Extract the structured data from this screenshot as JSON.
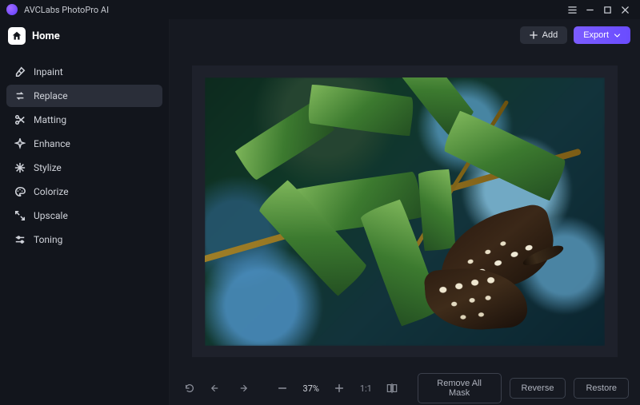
{
  "app": {
    "title": "AVCLabs PhotoPro AI"
  },
  "header": {
    "home_label": "Home",
    "add_label": "Add",
    "export_label": "Export"
  },
  "sidebar": {
    "tools": [
      {
        "id": "inpaint",
        "label": "Inpaint",
        "icon": "eraser-icon",
        "active": false
      },
      {
        "id": "replace",
        "label": "Replace",
        "icon": "swap-icon",
        "active": true
      },
      {
        "id": "matting",
        "label": "Matting",
        "icon": "scissors-icon",
        "active": false
      },
      {
        "id": "enhance",
        "label": "Enhance",
        "icon": "sparkle-icon",
        "active": false
      },
      {
        "id": "stylize",
        "label": "Stylize",
        "icon": "snowflake-icon",
        "active": false
      },
      {
        "id": "colorize",
        "label": "Colorize",
        "icon": "palette-icon",
        "active": false
      },
      {
        "id": "upscale",
        "label": "Upscale",
        "icon": "expand-icon",
        "active": false
      },
      {
        "id": "toning",
        "label": "Toning",
        "icon": "sliders-icon",
        "active": false
      }
    ]
  },
  "canvas": {
    "image_description": "Brown butterfly with white spots perched on green leaves of a yellow-stemmed branch, blurred blue-green bokeh background",
    "zoom_percent": "37%"
  },
  "bottom": {
    "fit_label": "1:1",
    "remove_mask_label": "Remove All Mask",
    "reverse_label": "Reverse",
    "restore_label": "Restore"
  }
}
